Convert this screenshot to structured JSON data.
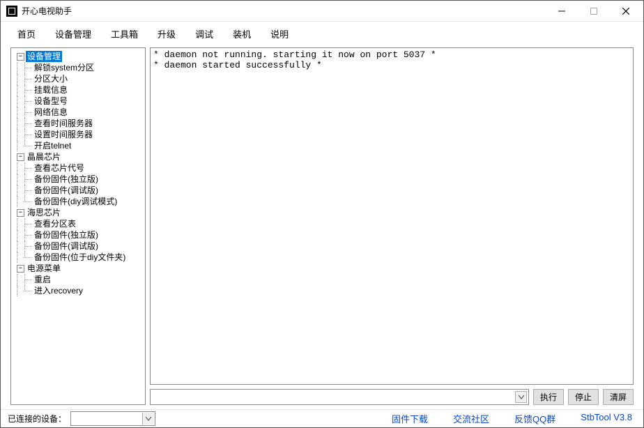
{
  "window": {
    "title": "开心电视助手"
  },
  "menu": {
    "items": [
      "首页",
      "设备管理",
      "工具箱",
      "升级",
      "调试",
      "装机",
      "说明"
    ]
  },
  "tree": {
    "nodes": [
      {
        "label": "设备管理",
        "selected": true,
        "children": [
          {
            "label": "解锁system分区"
          },
          {
            "label": "分区大小"
          },
          {
            "label": "挂载信息"
          },
          {
            "label": "设备型号"
          },
          {
            "label": "网络信息"
          },
          {
            "label": "查看时间服务器"
          },
          {
            "label": "设置时间服务器"
          },
          {
            "label": "开启telnet"
          }
        ]
      },
      {
        "label": "晶晨芯片",
        "children": [
          {
            "label": "查看芯片代号"
          },
          {
            "label": "备份固件(独立版)"
          },
          {
            "label": "备份固件(调试版)"
          },
          {
            "label": "备份固件(diy调试模式)"
          }
        ]
      },
      {
        "label": "海思芯片",
        "children": [
          {
            "label": "查看分区表"
          },
          {
            "label": "备份固件(独立版)"
          },
          {
            "label": "备份固件(调试版)"
          },
          {
            "label": "备份固件(位于diy文件夹)"
          }
        ]
      },
      {
        "label": "电源菜单",
        "children": [
          {
            "label": "重启"
          },
          {
            "label": "进入recovery"
          }
        ]
      }
    ]
  },
  "output": {
    "lines": [
      "* daemon not running. starting it now on port 5037 *",
      "* daemon started successfully *"
    ]
  },
  "cmd": {
    "value": "",
    "exec": "执行",
    "stop": "停止",
    "clear": "清屏"
  },
  "status": {
    "connected_label": "已连接的设备：",
    "links": [
      "固件下载",
      "交流社区",
      "反馈QQ群"
    ],
    "version": "StbTool V3.8"
  },
  "glyph": {
    "minus": "−"
  }
}
